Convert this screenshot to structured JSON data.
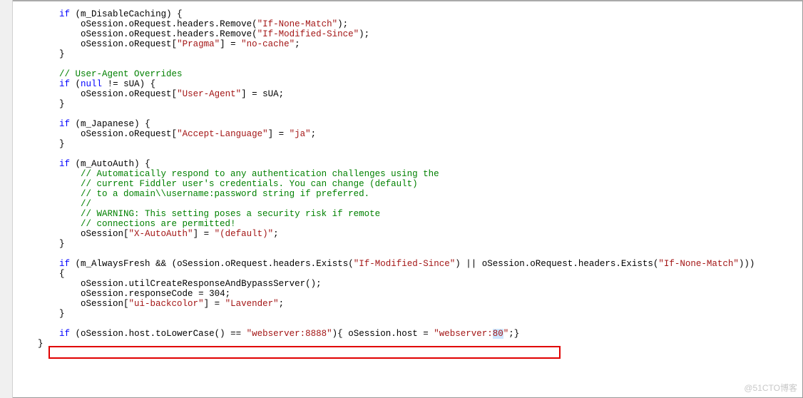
{
  "code_lines": [
    {
      "indent": 2,
      "tokens": [
        [
          "kw",
          "if"
        ],
        [
          "op",
          " ("
        ],
        [
          "ident",
          "m_DisableCaching"
        ],
        [
          "op",
          ") {"
        ]
      ]
    },
    {
      "indent": 3,
      "tokens": [
        [
          "ident",
          "oSession"
        ],
        [
          "op",
          "."
        ],
        [
          "ident",
          "oRequest"
        ],
        [
          "op",
          "."
        ],
        [
          "ident",
          "headers"
        ],
        [
          "op",
          "."
        ],
        [
          "ident",
          "Remove"
        ],
        [
          "op",
          "("
        ],
        [
          "str",
          "\"If-None-Match\""
        ],
        [
          "op",
          ");"
        ]
      ]
    },
    {
      "indent": 3,
      "tokens": [
        [
          "ident",
          "oSession"
        ],
        [
          "op",
          "."
        ],
        [
          "ident",
          "oRequest"
        ],
        [
          "op",
          "."
        ],
        [
          "ident",
          "headers"
        ],
        [
          "op",
          "."
        ],
        [
          "ident",
          "Remove"
        ],
        [
          "op",
          "("
        ],
        [
          "str",
          "\"If-Modified-Since\""
        ],
        [
          "op",
          ");"
        ]
      ]
    },
    {
      "indent": 3,
      "tokens": [
        [
          "ident",
          "oSession"
        ],
        [
          "op",
          "."
        ],
        [
          "ident",
          "oRequest"
        ],
        [
          "op",
          "["
        ],
        [
          "str",
          "\"Pragma\""
        ],
        [
          "op",
          "] = "
        ],
        [
          "str",
          "\"no-cache\""
        ],
        [
          "op",
          ";"
        ]
      ]
    },
    {
      "indent": 2,
      "tokens": [
        [
          "op",
          "}"
        ]
      ]
    },
    {
      "indent": 2,
      "tokens": []
    },
    {
      "indent": 2,
      "tokens": [
        [
          "cmt",
          "// User-Agent Overrides"
        ]
      ]
    },
    {
      "indent": 2,
      "tokens": [
        [
          "kw",
          "if"
        ],
        [
          "op",
          " ("
        ],
        [
          "kw",
          "null"
        ],
        [
          "op",
          " != "
        ],
        [
          "ident",
          "sUA"
        ],
        [
          "op",
          ") {"
        ]
      ]
    },
    {
      "indent": 3,
      "tokens": [
        [
          "ident",
          "oSession"
        ],
        [
          "op",
          "."
        ],
        [
          "ident",
          "oRequest"
        ],
        [
          "op",
          "["
        ],
        [
          "str",
          "\"User-Agent\""
        ],
        [
          "op",
          "] = "
        ],
        [
          "ident",
          "sUA"
        ],
        [
          "op",
          ";"
        ]
      ]
    },
    {
      "indent": 2,
      "tokens": [
        [
          "op",
          "}"
        ]
      ]
    },
    {
      "indent": 2,
      "tokens": []
    },
    {
      "indent": 2,
      "tokens": [
        [
          "kw",
          "if"
        ],
        [
          "op",
          " ("
        ],
        [
          "ident",
          "m_Japanese"
        ],
        [
          "op",
          ") {"
        ]
      ]
    },
    {
      "indent": 3,
      "tokens": [
        [
          "ident",
          "oSession"
        ],
        [
          "op",
          "."
        ],
        [
          "ident",
          "oRequest"
        ],
        [
          "op",
          "["
        ],
        [
          "str",
          "\"Accept-Language\""
        ],
        [
          "op",
          "] = "
        ],
        [
          "str",
          "\"ja\""
        ],
        [
          "op",
          ";"
        ]
      ]
    },
    {
      "indent": 2,
      "tokens": [
        [
          "op",
          "}"
        ]
      ]
    },
    {
      "indent": 2,
      "tokens": []
    },
    {
      "indent": 2,
      "tokens": [
        [
          "kw",
          "if"
        ],
        [
          "op",
          " ("
        ],
        [
          "ident",
          "m_AutoAuth"
        ],
        [
          "op",
          ") {"
        ]
      ]
    },
    {
      "indent": 3,
      "tokens": [
        [
          "cmt",
          "// Automatically respond to any authentication challenges using the"
        ]
      ]
    },
    {
      "indent": 3,
      "tokens": [
        [
          "cmt",
          "// current Fiddler user's credentials. You can change (default)"
        ]
      ]
    },
    {
      "indent": 3,
      "tokens": [
        [
          "cmt",
          "// to a domain\\\\username:password string if preferred."
        ]
      ]
    },
    {
      "indent": 3,
      "tokens": [
        [
          "cmt",
          "//"
        ]
      ]
    },
    {
      "indent": 3,
      "tokens": [
        [
          "cmt",
          "// WARNING: This setting poses a security risk if remote"
        ]
      ]
    },
    {
      "indent": 3,
      "tokens": [
        [
          "cmt",
          "// connections are permitted!"
        ]
      ]
    },
    {
      "indent": 3,
      "tokens": [
        [
          "ident",
          "oSession"
        ],
        [
          "op",
          "["
        ],
        [
          "str",
          "\"X-AutoAuth\""
        ],
        [
          "op",
          "] = "
        ],
        [
          "str",
          "\"(default)\""
        ],
        [
          "op",
          ";"
        ]
      ]
    },
    {
      "indent": 2,
      "tokens": [
        [
          "op",
          "}"
        ]
      ]
    },
    {
      "indent": 2,
      "tokens": []
    },
    {
      "indent": 2,
      "tokens": [
        [
          "kw",
          "if"
        ],
        [
          "op",
          " ("
        ],
        [
          "ident",
          "m_AlwaysFresh"
        ],
        [
          "op",
          " && ("
        ],
        [
          "ident",
          "oSession"
        ],
        [
          "op",
          "."
        ],
        [
          "ident",
          "oRequest"
        ],
        [
          "op",
          "."
        ],
        [
          "ident",
          "headers"
        ],
        [
          "op",
          "."
        ],
        [
          "ident",
          "Exists"
        ],
        [
          "op",
          "("
        ],
        [
          "str",
          "\"If-Modified-Since\""
        ],
        [
          "op",
          ") || "
        ],
        [
          "ident",
          "oSession"
        ],
        [
          "op",
          "."
        ],
        [
          "ident",
          "oRequest"
        ],
        [
          "op",
          "."
        ],
        [
          "ident",
          "headers"
        ],
        [
          "op",
          "."
        ],
        [
          "ident",
          "Exists"
        ],
        [
          "op",
          "("
        ],
        [
          "str",
          "\"If-None-Match\""
        ],
        [
          "op",
          ")))"
        ]
      ]
    },
    {
      "indent": 2,
      "tokens": [
        [
          "op",
          "{"
        ]
      ]
    },
    {
      "indent": 3,
      "tokens": [
        [
          "ident",
          "oSession"
        ],
        [
          "op",
          "."
        ],
        [
          "ident",
          "utilCreateResponseAndBypassServer"
        ],
        [
          "op",
          "();"
        ]
      ]
    },
    {
      "indent": 3,
      "tokens": [
        [
          "ident",
          "oSession"
        ],
        [
          "op",
          "."
        ],
        [
          "ident",
          "responseCode"
        ],
        [
          "op",
          " = "
        ],
        [
          "num",
          "304"
        ],
        [
          "op",
          ";"
        ]
      ]
    },
    {
      "indent": 3,
      "tokens": [
        [
          "ident",
          "oSession"
        ],
        [
          "op",
          "["
        ],
        [
          "str",
          "\"ui-backcolor\""
        ],
        [
          "op",
          "] = "
        ],
        [
          "str",
          "\"Lavender\""
        ],
        [
          "op",
          ";"
        ]
      ]
    },
    {
      "indent": 2,
      "tokens": [
        [
          "op",
          "}"
        ]
      ]
    },
    {
      "indent": 2,
      "tokens": []
    },
    {
      "indent": 2,
      "tokens": [
        [
          "kw",
          "if"
        ],
        [
          "op",
          " ("
        ],
        [
          "ident",
          "oSession"
        ],
        [
          "op",
          "."
        ],
        [
          "ident",
          "host"
        ],
        [
          "op",
          "."
        ],
        [
          "ident",
          "toLowerCase"
        ],
        [
          "op",
          "() == "
        ],
        [
          "str",
          "\"webserver:8888\""
        ],
        [
          "op",
          "){ "
        ],
        [
          "ident",
          "oSession"
        ],
        [
          "op",
          "."
        ],
        [
          "ident",
          "host"
        ],
        [
          "op",
          " = "
        ],
        [
          "str",
          "\"webserver:"
        ],
        [
          "sel",
          "80"
        ],
        [
          "str",
          "\""
        ],
        [
          "op",
          ";}"
        ]
      ]
    },
    {
      "indent": 1,
      "tokens": [
        [
          "op",
          "}"
        ]
      ]
    }
  ],
  "watermark": "@51CTO博客"
}
